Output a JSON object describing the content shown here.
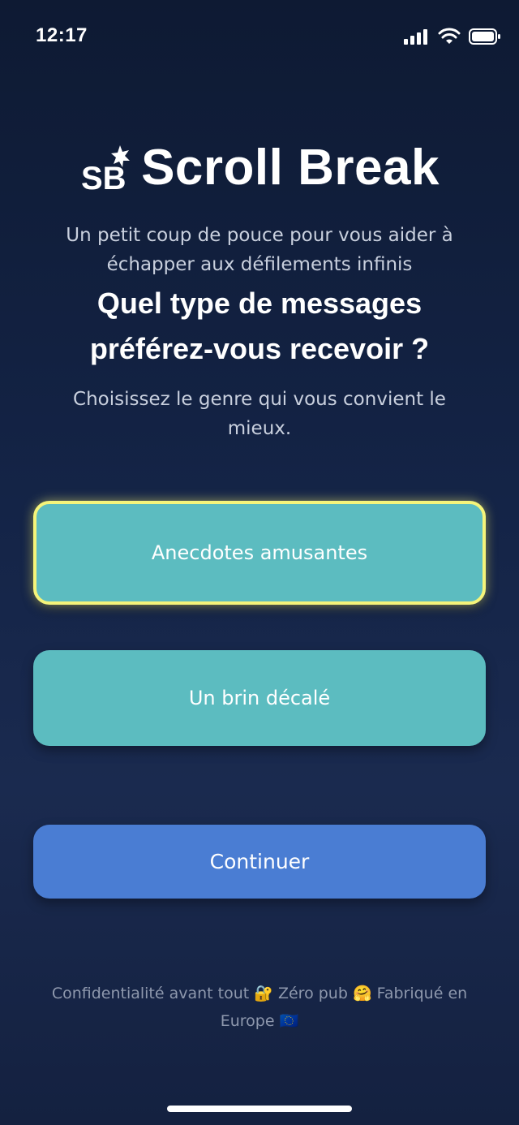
{
  "status_bar": {
    "time": "12:17"
  },
  "header": {
    "logo_text": "SB",
    "app_name": "Scroll Break",
    "tagline": "Un petit coup de pouce pour vous aider à échapper aux défilements infinis"
  },
  "main": {
    "question": "Quel type de messages préférez-vous recevoir ?",
    "instruction": "Choisissez le genre qui vous convient le mieux.",
    "options": [
      {
        "label": "Anecdotes amusantes",
        "selected": true
      },
      {
        "label": "Un brin décalé",
        "selected": false
      }
    ],
    "continue_label": "Continuer"
  },
  "footer": {
    "note": "Confidentialité avant tout 🔐 Zéro pub 🤗 Fabriqué en Europe 🇪🇺"
  },
  "colors": {
    "background_top": "#0e1a33",
    "background_bottom": "#1a2a4f",
    "option_fill": "#5cbcc0",
    "selected_border": "#f5f47a",
    "continue_button": "#4a7dd3",
    "muted_text": "#c9d0de"
  }
}
